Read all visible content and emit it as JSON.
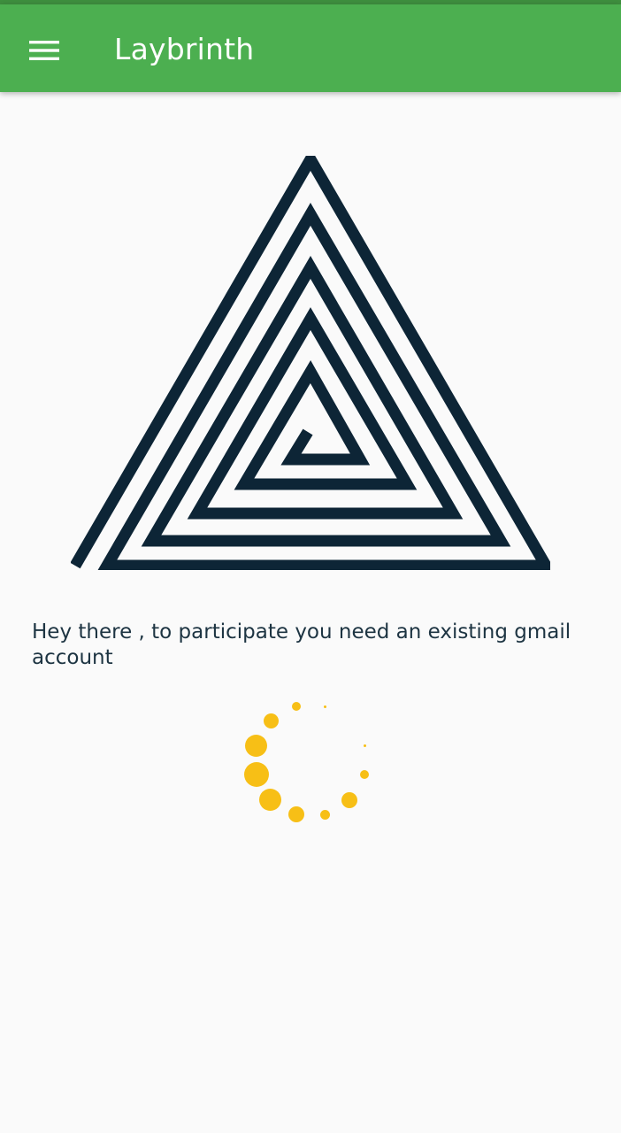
{
  "app_bar": {
    "title": "Laybrinth",
    "menu_icon": "hamburger-menu-icon",
    "background_color": "#4caf50"
  },
  "logo": {
    "icon": "triangle-spiral-labyrinth-logo",
    "color": "#0d2536"
  },
  "main": {
    "message": "Hey there , to participate you need an existing gmail account"
  },
  "loading_indicator": {
    "icon": "loading-spinner-icon",
    "color": "#f7bf16"
  }
}
